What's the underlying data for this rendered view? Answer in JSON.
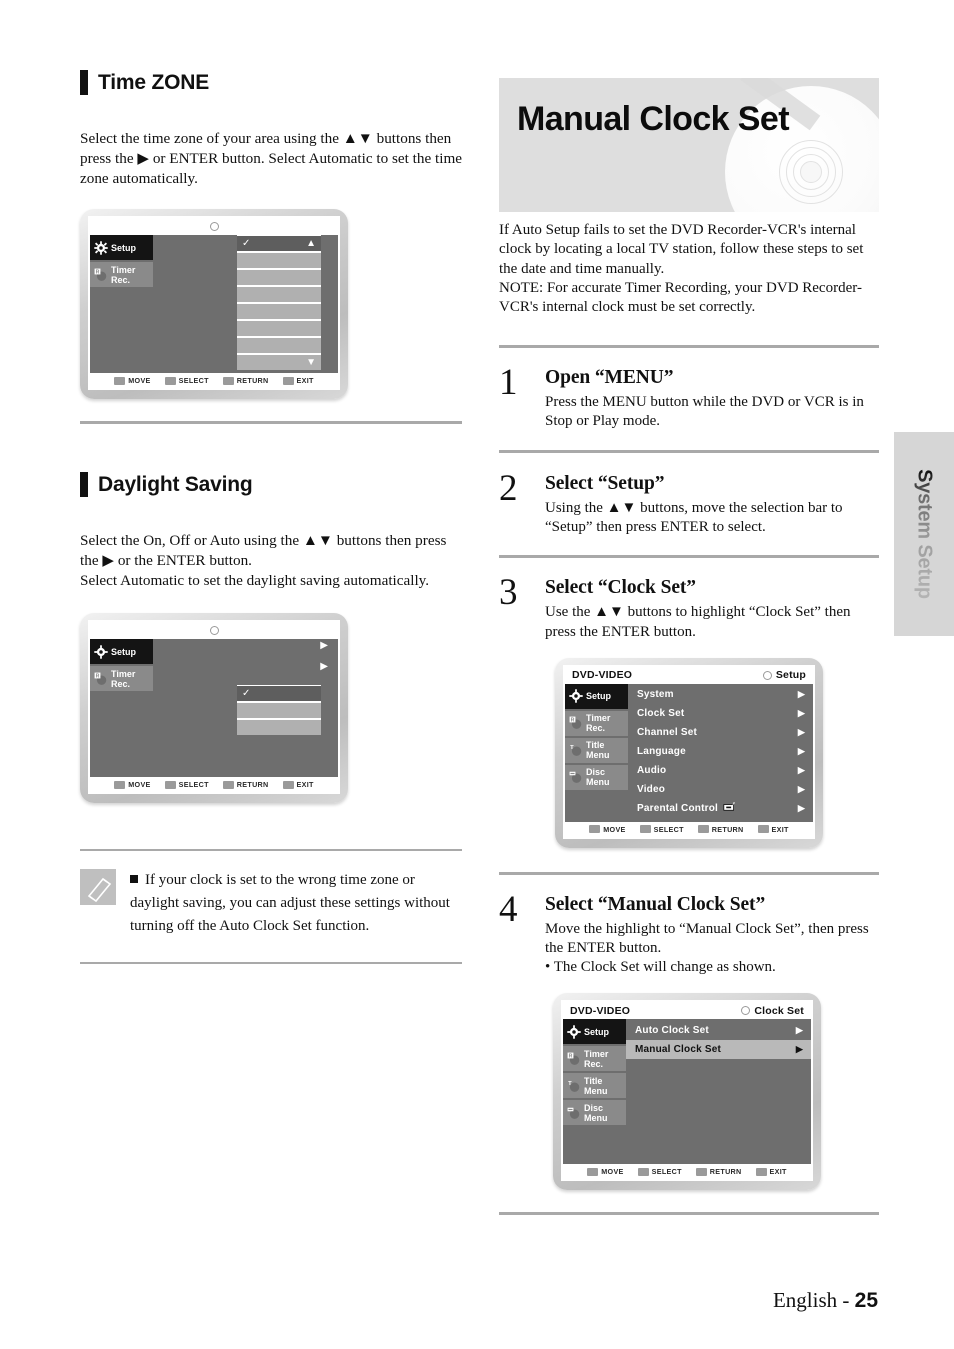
{
  "left_column": {
    "section1": {
      "heading": "Time ZONE",
      "paragraph": "Select the time zone of your area using the ▲▼ buttons then press the ▶ or ENTER button. Select Automatic to set the time zone automatically."
    },
    "section2": {
      "heading": "Daylight Saving",
      "paragraph": "Select the On, Off or Auto using the ▲▼ buttons then press the ▶ or the ENTER button.\nSelect Automatic to set the daylight saving automatically."
    },
    "note": {
      "icon": "pencil-icon",
      "text": "If your clock is set to the wrong time zone or daylight saving, you can adjust these settings without turning off the Auto Clock Set function."
    }
  },
  "osd_screens": {
    "timezone": {
      "title_left": "",
      "title_right": "",
      "sidebar": [
        {
          "label": "Setup",
          "icon": "gear-icon",
          "active": true
        },
        {
          "label": "Timer Rec.",
          "icon": "timer-rec-icon",
          "active": false
        }
      ],
      "list_rows": 8,
      "selected_index": 0,
      "scroll_up": "▲",
      "scroll_down": "▼",
      "check": "✓",
      "footer": [
        {
          "label": "MOVE",
          "icon": "updown-key-icon"
        },
        {
          "label": "SELECT",
          "icon": "enter-key-icon"
        },
        {
          "label": "RETURN",
          "icon": "return-key-icon"
        },
        {
          "label": "EXIT",
          "icon": "exit-key-icon"
        }
      ]
    },
    "daylight": {
      "sidebar": [
        {
          "label": "Setup",
          "icon": "gear-icon",
          "active": true
        },
        {
          "label": "Timer Rec.",
          "icon": "timer-rec-icon",
          "active": false
        }
      ],
      "arrows": [
        "▶",
        "▶"
      ],
      "list_rows": 3,
      "selected_index": 0,
      "check": "✓",
      "footer": [
        {
          "label": "MOVE",
          "icon": "updown-key-icon"
        },
        {
          "label": "SELECT",
          "icon": "enter-key-icon"
        },
        {
          "label": "RETURN",
          "icon": "return-key-icon"
        },
        {
          "label": "EXIT",
          "icon": "exit-key-icon"
        }
      ]
    },
    "setup_menu": {
      "title_left": "DVD-VIDEO",
      "title_right": "Setup",
      "sidebar": [
        {
          "label": "Setup",
          "icon": "gear-icon",
          "active": true
        },
        {
          "label": "Timer Rec.",
          "icon": "timer-rec-icon",
          "active": false
        },
        {
          "label": "Title Menu",
          "icon": "title-menu-icon",
          "active": false
        },
        {
          "label": "Disc Menu",
          "icon": "disc-menu-icon",
          "active": false
        }
      ],
      "items": [
        {
          "label": "System",
          "arrow": "▶",
          "highlight": false
        },
        {
          "label": "Clock Set",
          "arrow": "▶",
          "highlight": false
        },
        {
          "label": "Channel Set",
          "arrow": "▶",
          "highlight": false
        },
        {
          "label": "Language",
          "arrow": "▶",
          "highlight": false
        },
        {
          "label": "Audio",
          "arrow": "▶",
          "highlight": false
        },
        {
          "label": "Video",
          "arrow": "▶",
          "highlight": false
        },
        {
          "label": "Parental Control",
          "arrow": "▶",
          "highlight": false,
          "badge": "lock-icon"
        }
      ],
      "footer": [
        {
          "label": "MOVE",
          "icon": "updown-key-icon"
        },
        {
          "label": "SELECT",
          "icon": "enter-key-icon"
        },
        {
          "label": "RETURN",
          "icon": "return-key-icon"
        },
        {
          "label": "EXIT",
          "icon": "exit-key-icon"
        }
      ]
    },
    "clock_set_menu": {
      "title_left": "DVD-VIDEO",
      "title_right": "Clock Set",
      "sidebar": [
        {
          "label": "Setup",
          "icon": "gear-icon",
          "active": true
        },
        {
          "label": "Timer Rec.",
          "icon": "timer-rec-icon",
          "active": false
        },
        {
          "label": "Title Menu",
          "icon": "title-menu-icon",
          "active": false
        },
        {
          "label": "Disc Menu",
          "icon": "disc-menu-icon",
          "active": false
        }
      ],
      "items": [
        {
          "label": "Auto Clock Set",
          "arrow": "▶",
          "highlight": false
        },
        {
          "label": "Manual Clock Set",
          "arrow": "▶",
          "highlight": true
        }
      ],
      "footer": [
        {
          "label": "MOVE",
          "icon": "updown-key-icon"
        },
        {
          "label": "SELECT",
          "icon": "enter-key-icon"
        },
        {
          "label": "RETURN",
          "icon": "return-key-icon"
        },
        {
          "label": "EXIT",
          "icon": "exit-key-icon"
        }
      ]
    }
  },
  "right_column": {
    "chapter_title": "Manual Clock Set",
    "intro": "If Auto Setup fails to set the DVD Recorder-VCR's internal clock by locating a local TV station, follow these steps to set the date and time manually.\nNOTE: For accurate Timer Recording, your DVD Recorder-VCR's internal clock must be set correctly.",
    "steps": [
      {
        "number": "1",
        "title": "Open “MENU”",
        "text": "Press the MENU button while the DVD or VCR is in Stop or Play mode."
      },
      {
        "number": "2",
        "title": "Select “Setup”",
        "text": "Using the ▲▼ buttons, move the selection bar to “Setup” then press ENTER to select."
      },
      {
        "number": "3",
        "title": "Select “Clock Set”",
        "text": "Use the ▲▼ buttons to highlight “Clock Set” then press the ENTER button."
      },
      {
        "number": "4",
        "title": "Select “Manual Clock Set”",
        "text": "Move the highlight to “Manual Clock Set”, then press the ENTER button.\n• The Clock Set will change as shown."
      }
    ]
  },
  "side_tab": {
    "label": "System Setup"
  },
  "footer": {
    "language": "English - ",
    "page": "25"
  },
  "colors": {
    "heading_bar": "#111111",
    "band_bg": "#dedede",
    "rule": "#a9a9a9",
    "osd_bg": "#6e6e6e",
    "osd_active": "#141414",
    "osd_highlight": "#b9b9b9",
    "side_tab_bg": "#d6d6d6"
  }
}
